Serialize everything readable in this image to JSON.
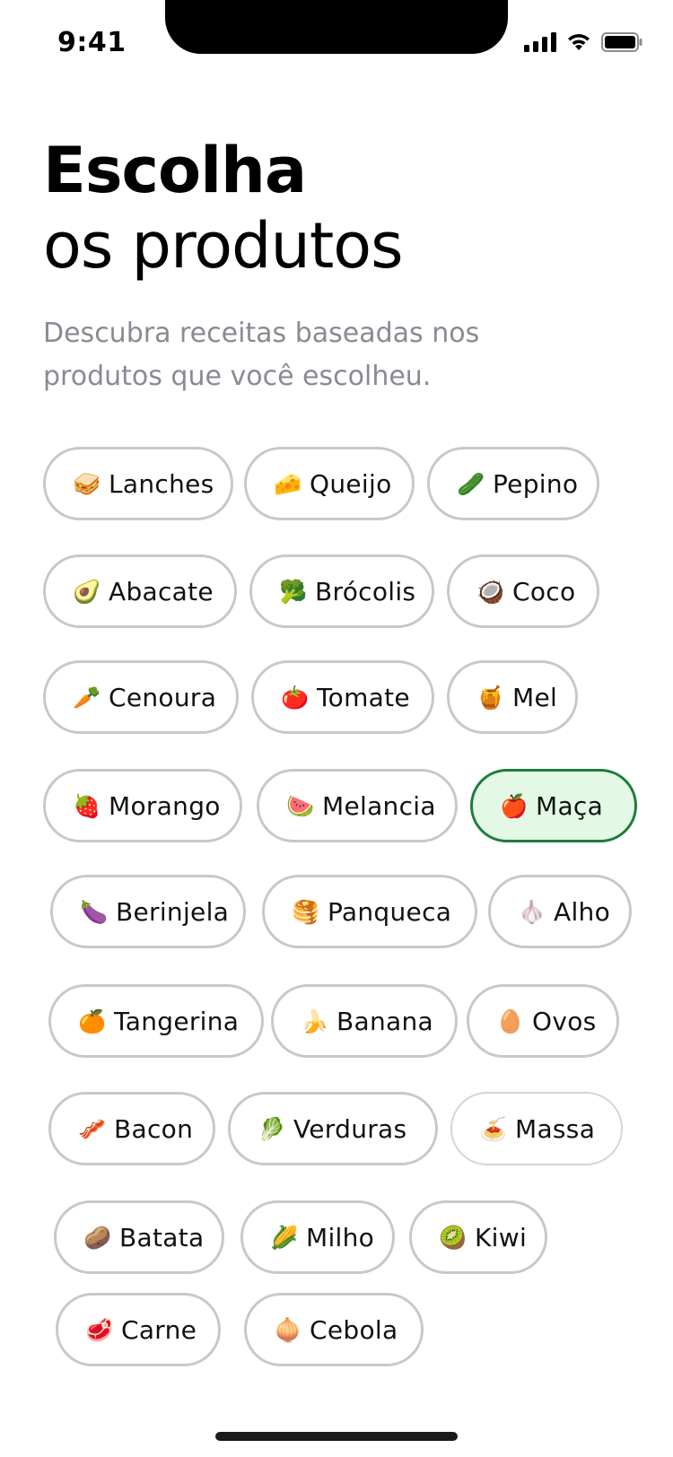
{
  "status_bar": {
    "time": "9:41"
  },
  "header": {
    "title_strong": "Escolha",
    "title_light": "os produtos",
    "subtitle": "Descubra receitas baseadas nos produtos que você escolheu."
  },
  "accent_colors": {
    "selected_bg": "#e3f9e5",
    "selected_border": "#1e7c3c",
    "chip_border": "#c7c7cf"
  },
  "chips": [
    {
      "label": "Lanches",
      "emoji": "🥪"
    },
    {
      "label": "Queijo",
      "emoji": "🧀"
    },
    {
      "label": "Pepino",
      "emoji": "🥒"
    },
    {
      "label": "Abacate",
      "emoji": "🥑"
    },
    {
      "label": "Brócolis",
      "emoji": "🥦"
    },
    {
      "label": "Coco",
      "emoji": "🥥"
    },
    {
      "label": "Cenoura",
      "emoji": "🥕"
    },
    {
      "label": "Tomate",
      "emoji": "🍅"
    },
    {
      "label": "Mel",
      "emoji": "🍯"
    },
    {
      "label": "Morango",
      "emoji": "🍓"
    },
    {
      "label": "Melancia",
      "emoji": "🍉"
    },
    {
      "label": "Maça",
      "emoji": "🍎",
      "selected": true
    },
    {
      "label": "Berinjela",
      "emoji": "🍆"
    },
    {
      "label": "Panqueca",
      "emoji": "🥞"
    },
    {
      "label": "Alho",
      "emoji": "🧄"
    },
    {
      "label": "Tangerina",
      "emoji": "🍊"
    },
    {
      "label": "Banana",
      "emoji": "🍌"
    },
    {
      "label": "Ovos",
      "emoji": "🥚"
    },
    {
      "label": "Bacon",
      "emoji": "🥓"
    },
    {
      "label": "Verduras",
      "emoji": "🥬"
    },
    {
      "label": "Massa",
      "emoji": "🍝"
    },
    {
      "label": "Batata",
      "emoji": "🥔"
    },
    {
      "label": "Milho",
      "emoji": "🌽"
    },
    {
      "label": "Kiwi",
      "emoji": "🥝"
    },
    {
      "label": "Carne",
      "emoji": "🥩"
    },
    {
      "label": "Cebola",
      "emoji": "🧅"
    }
  ]
}
